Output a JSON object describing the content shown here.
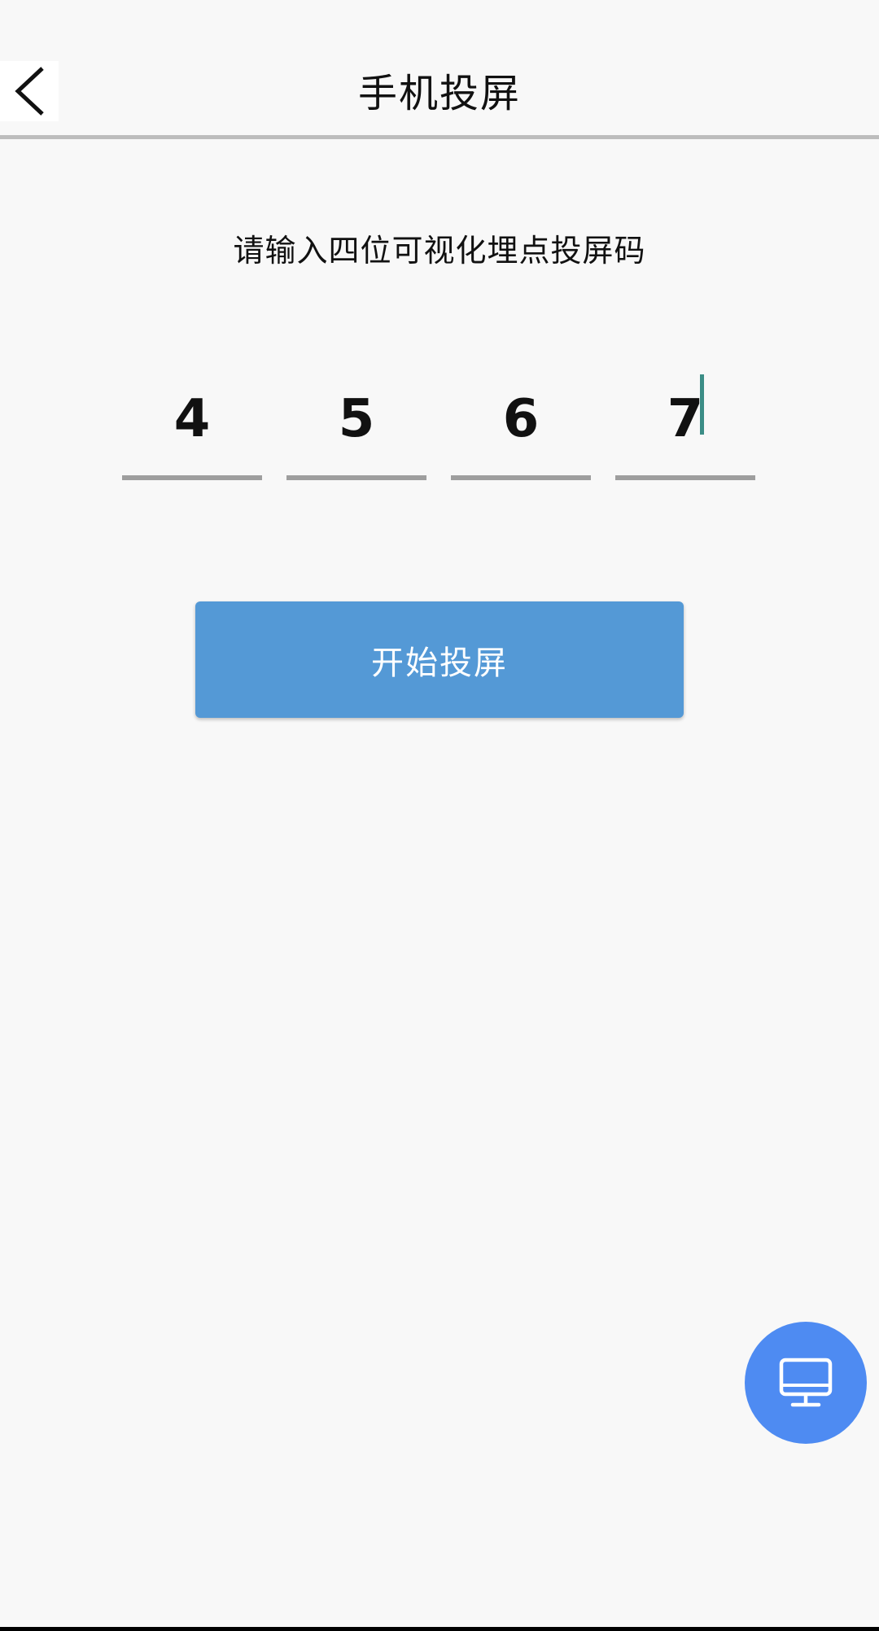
{
  "header": {
    "title": "手机投屏",
    "back_icon": "chevron-left-icon"
  },
  "main": {
    "instruction": "请输入四位可视化埋点投屏码",
    "code_digits": [
      "4",
      "5",
      "6",
      "7"
    ],
    "start_button_label": "开始投屏"
  },
  "fab": {
    "icon": "monitor-icon"
  },
  "colors": {
    "background": "#f8f8f8",
    "button": "#5499d6",
    "fab": "#4e8bf2",
    "underline": "#9e9e9e",
    "cursor": "#3b8d86"
  }
}
